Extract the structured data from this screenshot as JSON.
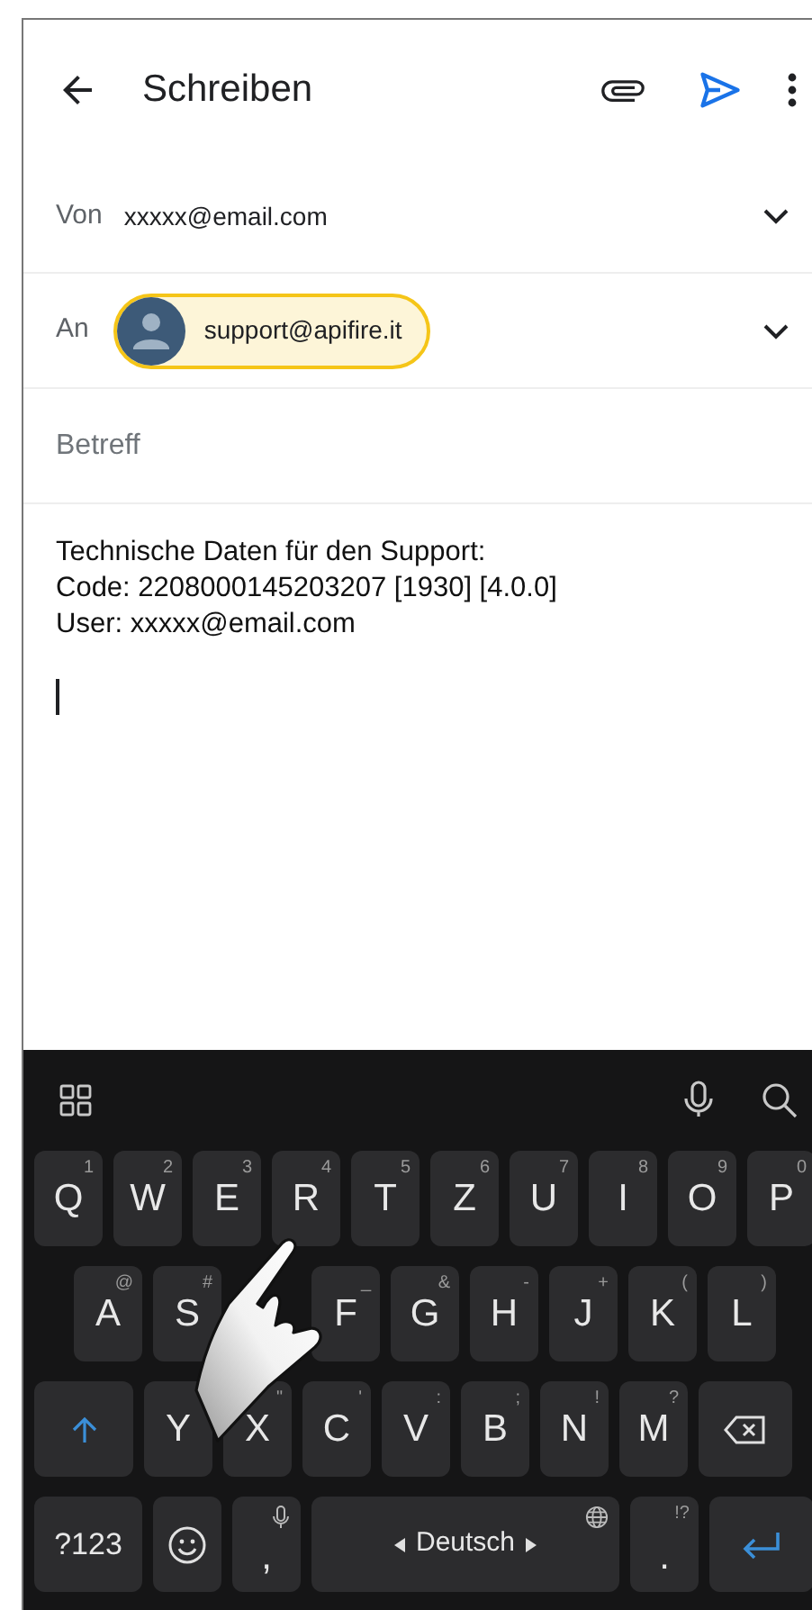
{
  "header": {
    "title": "Schreiben"
  },
  "from": {
    "label": "Von",
    "value": "xxxxx@email.com"
  },
  "to": {
    "label": "An",
    "recipients": [
      {
        "address": "support@apifire.it",
        "selected": true
      }
    ]
  },
  "subject": {
    "placeholder": "Betreff"
  },
  "body": {
    "lines": [
      "Technische Daten für den Support:",
      "Code: 2208000145203207 [1930] [4.0.0]",
      "User: xxxxx@email.com"
    ]
  },
  "keyboard": {
    "key_rows": [
      [
        {
          "kind": "letter",
          "label": "Q",
          "hint": "1"
        },
        {
          "kind": "letter",
          "label": "W",
          "hint": "2"
        },
        {
          "kind": "letter",
          "label": "E",
          "hint": "3"
        },
        {
          "kind": "letter",
          "label": "R",
          "hint": "4"
        },
        {
          "kind": "letter",
          "label": "T",
          "hint": "5"
        },
        {
          "kind": "letter",
          "label": "Z",
          "hint": "6"
        },
        {
          "kind": "letter",
          "label": "U",
          "hint": "7"
        },
        {
          "kind": "letter",
          "label": "I",
          "hint": "8"
        },
        {
          "kind": "letter",
          "label": "O",
          "hint": "9"
        },
        {
          "kind": "letter",
          "label": "P",
          "hint": "0"
        }
      ],
      [
        {
          "kind": "letter",
          "label": "A",
          "hint": "@"
        },
        {
          "kind": "letter",
          "label": "S",
          "hint": "#"
        },
        {
          "kind": "covered"
        },
        {
          "kind": "letter",
          "label": "F",
          "hint": "_"
        },
        {
          "kind": "letter",
          "label": "G",
          "hint": "&"
        },
        {
          "kind": "letter",
          "label": "H",
          "hint": "-"
        },
        {
          "kind": "letter",
          "label": "J",
          "hint": "+"
        },
        {
          "kind": "letter",
          "label": "K",
          "hint": "("
        },
        {
          "kind": "letter",
          "label": "L",
          "hint": ")"
        }
      ],
      [
        {
          "kind": "shift"
        },
        {
          "kind": "letter",
          "label": "Y"
        },
        {
          "kind": "letter",
          "label": "X",
          "hint": "\""
        },
        {
          "kind": "letter",
          "label": "C",
          "hint": "'"
        },
        {
          "kind": "letter",
          "label": "V",
          "hint": ":"
        },
        {
          "kind": "letter",
          "label": "B",
          "hint": ";"
        },
        {
          "kind": "letter",
          "label": "N",
          "hint": "!"
        },
        {
          "kind": "letter",
          "label": "M",
          "hint": "?"
        },
        {
          "kind": "backspace"
        }
      ],
      [
        {
          "kind": "symbols",
          "label": "?123"
        },
        {
          "kind": "emoji"
        },
        {
          "kind": "comma",
          "label": ","
        },
        {
          "kind": "space",
          "label": "Deutsch"
        },
        {
          "kind": "period",
          "label": ".",
          "hint": "!?"
        },
        {
          "kind": "enter"
        }
      ]
    ]
  }
}
